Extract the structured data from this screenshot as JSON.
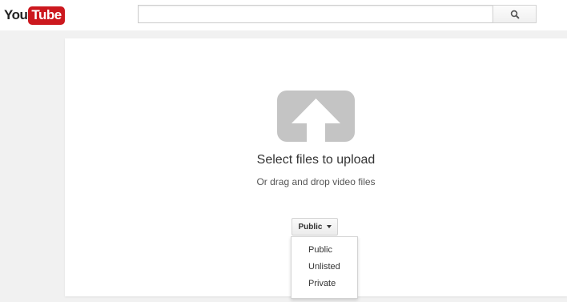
{
  "header": {
    "logo": {
      "you": "You",
      "tube": "Tube"
    },
    "search": {
      "value": "",
      "placeholder": "",
      "button_icon": "search-icon"
    }
  },
  "upload": {
    "icon": "upload-arrow-icon",
    "title": "Select files to upload",
    "subtitle": "Or drag and drop video files",
    "privacy": {
      "selected": "Public",
      "options": [
        "Public",
        "Unlisted",
        "Private"
      ]
    }
  },
  "colors": {
    "brand_red": "#cc181e",
    "page_background": "#f1f1f1",
    "panel_background": "#ffffff",
    "icon_gray": "#c4c4c4"
  }
}
